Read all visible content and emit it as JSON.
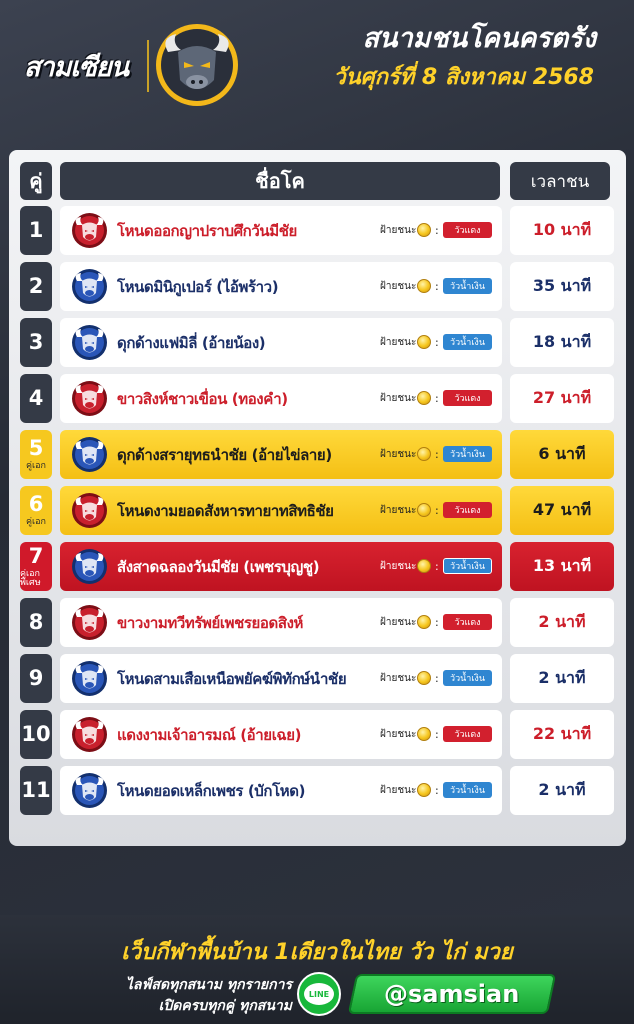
{
  "header": {
    "brand": "สามเซียน",
    "title": "สนามชนโคนครตรัง",
    "date": "วันศุกร์ที่ 8 สิงหาคม 2568"
  },
  "table": {
    "col_pair": "คู่",
    "col_name": "ชื่อโค",
    "col_time": "เวลาชน",
    "win_label": "ฝ้ายชนะ",
    "colon": ":"
  },
  "rows": [
    {
      "num": "1",
      "tag": "",
      "style": "normal",
      "bull": "red",
      "fighter": "โหนดออกญาปราบศึกวันมีชัย",
      "side": "วัวแดง",
      "time": "10 นาที"
    },
    {
      "num": "2",
      "tag": "",
      "style": "normal",
      "bull": "blue",
      "fighter": "โหนดมินิกูเปอร์ (ไอ้พร้าว)",
      "side": "วัวน้ำเงิน",
      "time": "35 นาที"
    },
    {
      "num": "3",
      "tag": "",
      "style": "normal",
      "bull": "blue",
      "fighter": "ดุกด้างแฟมิลี่ (อ้ายน้อง)",
      "side": "วัวน้ำเงิน",
      "time": "18 นาที"
    },
    {
      "num": "4",
      "tag": "",
      "style": "normal",
      "bull": "red",
      "fighter": "ขาวสิงห์ชาวเขื่อน (ทองคำ)",
      "side": "วัวแดง",
      "time": "27 นาที"
    },
    {
      "num": "5",
      "tag": "คู่เอก",
      "style": "gold",
      "bull": "blue",
      "fighter": "ดุกด้างสรายุทธนำชัย (อ้ายไข่ลาย)",
      "side": "วัวน้ำเงิน",
      "time": "6 นาที"
    },
    {
      "num": "6",
      "tag": "คู่เอก",
      "style": "gold",
      "bull": "red",
      "fighter": "โหนดงามยอดสังหารทายาทสิทธิชัย",
      "side": "วัวแดง",
      "time": "47 นาที"
    },
    {
      "num": "7",
      "tag": "คู่เอกพิเศษ",
      "style": "red",
      "bull": "blue",
      "fighter": "สังสาดฉลองวันมีชัย (เพชรบุญชู)",
      "side": "วัวน้ำเงิน",
      "time": "13 นาที"
    },
    {
      "num": "8",
      "tag": "",
      "style": "normal",
      "bull": "red",
      "fighter": "ขาวงามทวีทรัพย์เพชรยอดสิงห์",
      "side": "วัวแดง",
      "time": "2 นาที"
    },
    {
      "num": "9",
      "tag": "",
      "style": "normal",
      "bull": "blue",
      "fighter": "โหนดสามเสือเหนือพยัคฆ์พิทักษ์นำชัย",
      "side": "วัวน้ำเงิน",
      "time": "2 นาที"
    },
    {
      "num": "10",
      "tag": "",
      "style": "normal",
      "bull": "red",
      "fighter": "แดงงามเจ้าอารมณ์ (อ้ายเฉย)",
      "side": "วัวแดง",
      "time": "22 นาที"
    },
    {
      "num": "11",
      "tag": "",
      "style": "normal",
      "bull": "blue",
      "fighter": "โหนดยอดเหล็กเพชร (บักโหด)",
      "side": "วัวน้ำเงิน",
      "time": "2 นาที"
    }
  ],
  "footer": {
    "slogan": "เว็บกีฬาพื้นบ้าน 1เดียวในไทย วัว ไก่ มวย",
    "line1": "ไลฟ์สดทุกสนาม ทุกรายการ",
    "line2": "เปิดครบทุกคู่ ทุกสนาม",
    "line_icon_text": "LINE",
    "line_id": "@samsian"
  },
  "colors": {
    "red": "#cc1e2a",
    "navy": "#1b2f68",
    "gold": "#f6c81f",
    "dark": "#343a46",
    "line_green": "#18b83b"
  }
}
